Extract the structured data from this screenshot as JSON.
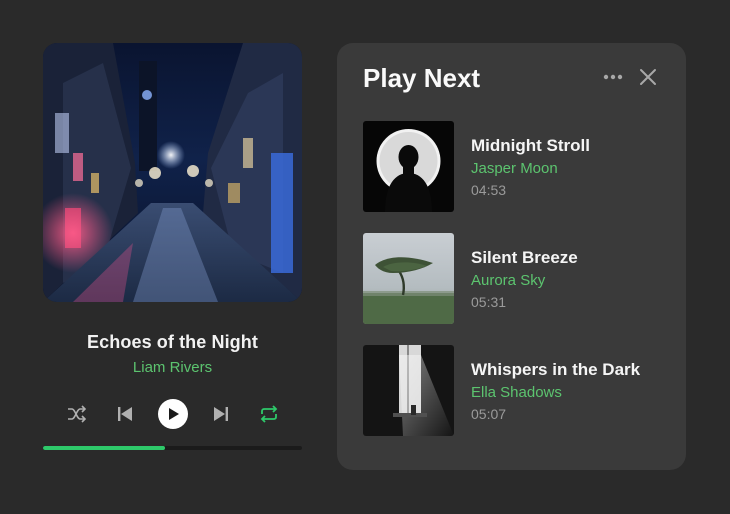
{
  "now_playing": {
    "title": "Echoes of the Night",
    "artist": "Liam Rivers",
    "progress": 0.47,
    "cover_icon": "night-street-artwork"
  },
  "controls": {
    "shuffle_icon": "shuffle-icon",
    "previous_icon": "skip-previous-icon",
    "play_icon": "play-icon",
    "next_icon": "skip-next-icon",
    "repeat_icon": "repeat-icon",
    "repeat_active": true
  },
  "queue_panel": {
    "title": "Play Next",
    "more_icon": "more-horizontal-icon",
    "close_icon": "close-icon",
    "items": [
      {
        "title": "Midnight Stroll",
        "artist": "Jasper Moon",
        "duration": "04:53",
        "thumb": "silhouette-moon-artwork"
      },
      {
        "title": "Silent Breeze",
        "artist": "Aurora Sky",
        "duration": "05:31",
        "thumb": "windswept-tree-artwork"
      },
      {
        "title": "Whispers in the Dark",
        "artist": "Ella Shadows",
        "duration": "05:07",
        "thumb": "light-window-artwork"
      }
    ]
  },
  "colors": {
    "background": "#2a2a2a",
    "panel": "#3a3a3a",
    "accent_green": "#2ec96a",
    "artist_green": "#5cc46f",
    "muted_text": "#9a9a9a"
  }
}
